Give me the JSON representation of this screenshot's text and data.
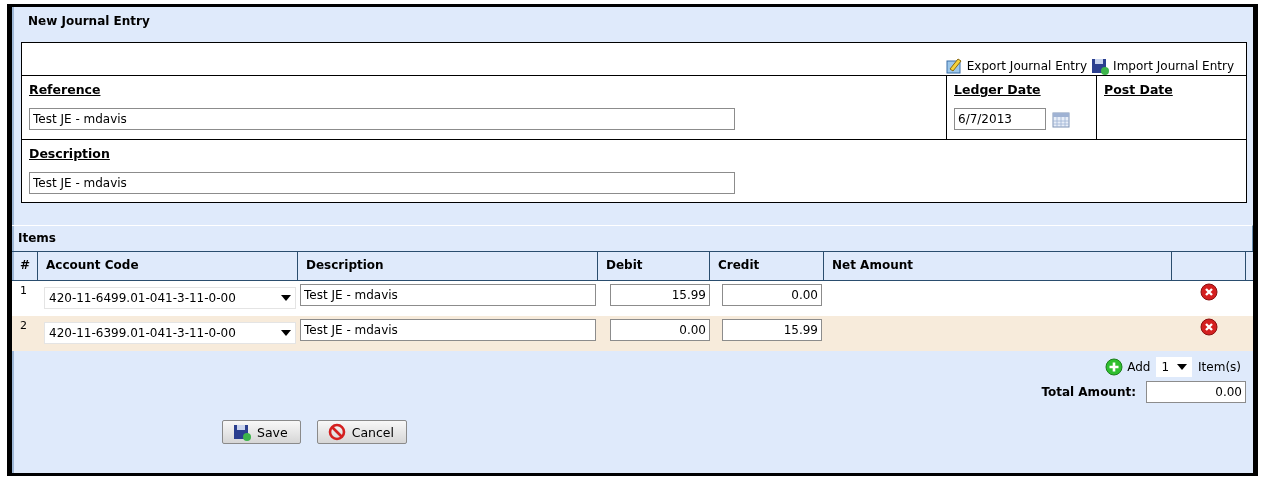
{
  "title": "New Journal Entry",
  "links": [
    {
      "kind": "export",
      "label": "Export Journal Entry"
    },
    {
      "kind": "import",
      "label": "Import Journal Entry"
    }
  ],
  "reference": {
    "label": "Reference",
    "value": "Test JE - mdavis"
  },
  "ledger_date": {
    "label": "Ledger Date",
    "value": "6/7/2013"
  },
  "post_date": {
    "label": "Post Date"
  },
  "description": {
    "label": "Description",
    "value": "Test JE - mdavis"
  },
  "items": {
    "title": "Items",
    "columns": [
      "#",
      "Account Code",
      "Description",
      "Debit",
      "Credit",
      "Net Amount"
    ],
    "rows": [
      {
        "number": "1",
        "account": "420-11-6499.01-041-3-11-0-00",
        "description": "Test JE - mdavis",
        "debit": "15.99",
        "credit": "0.00"
      },
      {
        "number": "2",
        "account": "420-11-6399.01-041-3-11-0-00",
        "description": "Test JE - mdavis",
        "debit": "0.00",
        "credit": "15.99"
      }
    ]
  },
  "add": {
    "label": "Add",
    "count": "1",
    "suffix": "Item(s)"
  },
  "total": {
    "label": "Total Amount:",
    "value": "0.00"
  },
  "buttons": [
    {
      "kind": "save",
      "label": "Save"
    },
    {
      "kind": "cancel",
      "label": "Cancel"
    }
  ]
}
